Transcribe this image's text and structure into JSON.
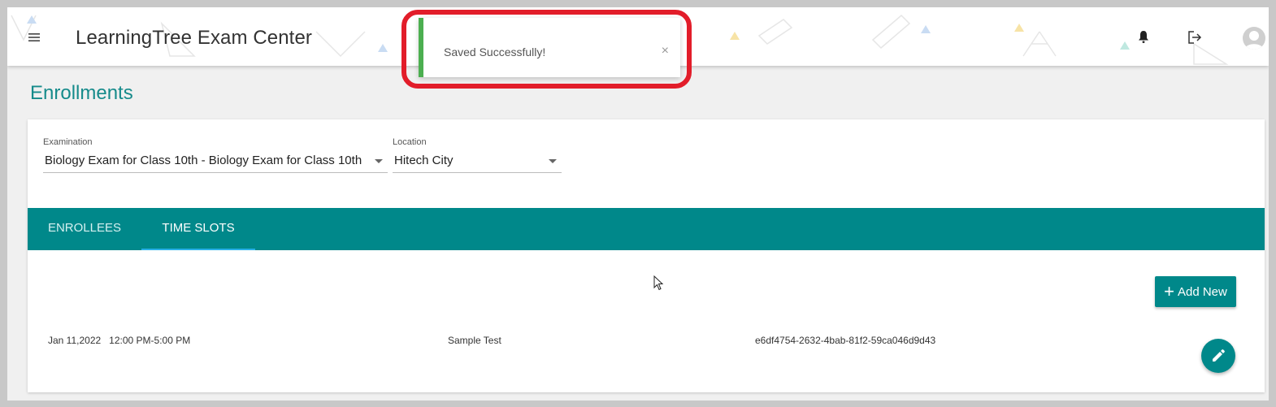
{
  "header": {
    "app_title": "LearningTree Exam Center",
    "menu_icon": "hamburger-menu-icon",
    "bell_icon": "bell-icon",
    "logout_icon": "logout-icon",
    "avatar_icon": "user-avatar-icon"
  },
  "toast": {
    "message": "Saved Successfully!",
    "close_label": "×",
    "accent_color": "#4caf50"
  },
  "page": {
    "title": "Enrollments"
  },
  "filters": {
    "examination_label": "Examination",
    "examination_value": "Biology Exam for Class 10th - Biology Exam for Class 10th",
    "location_label": "Location",
    "location_value": "Hitech City"
  },
  "tabs": [
    {
      "label": "ENROLLEES",
      "active": false
    },
    {
      "label": "TIME SLOTS",
      "active": true
    }
  ],
  "actions": {
    "add_new_label": "Add New",
    "add_icon": "plus-icon",
    "edit_icon": "pencil-icon"
  },
  "time_slots": [
    {
      "date_time": "Jan 11,2022   12:00 PM-5:00 PM",
      "name": "Sample Test",
      "id": "e6df4754-2632-4bab-81f2-59ca046d9d43"
    }
  ],
  "colors": {
    "primary": "#00888a",
    "title": "#168b8b",
    "highlight": "#e21d2a",
    "tab_indicator": "#27b0e6"
  }
}
